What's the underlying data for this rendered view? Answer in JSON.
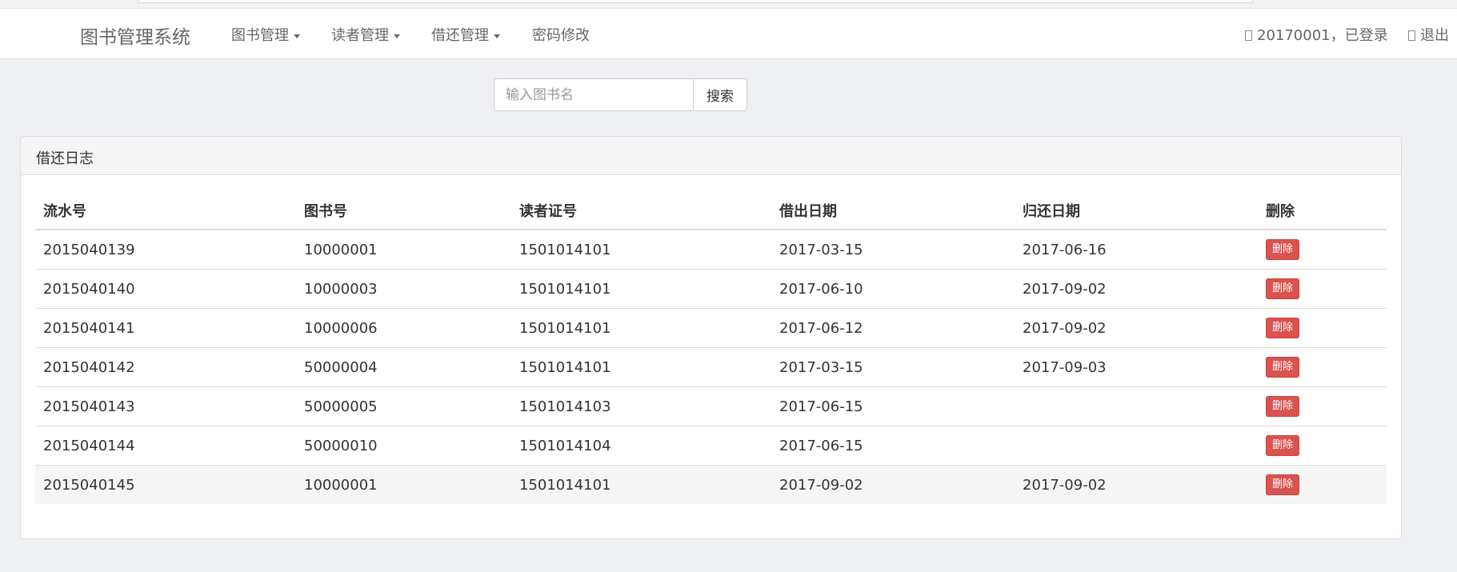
{
  "navbar": {
    "brand": "图书管理系统",
    "menu": [
      {
        "label": "图书管理",
        "dropdown": true
      },
      {
        "label": "读者管理",
        "dropdown": true
      },
      {
        "label": "借还管理",
        "dropdown": true
      },
      {
        "label": "密码修改",
        "dropdown": false
      }
    ],
    "user_status": "20170001，已登录",
    "logout_label": "退出"
  },
  "search": {
    "placeholder": "输入图书名",
    "value": "",
    "button_label": "搜索"
  },
  "panel": {
    "title": "借还日志",
    "columns": [
      "流水号",
      "图书号",
      "读者证号",
      "借出日期",
      "归还日期",
      "删除"
    ],
    "rows": [
      {
        "serial": "2015040139",
        "book_id": "10000001",
        "reader_id": "1501014101",
        "lend_date": "2017-03-15",
        "return_date": "2017-06-16",
        "delete_label": "删除"
      },
      {
        "serial": "2015040140",
        "book_id": "10000003",
        "reader_id": "1501014101",
        "lend_date": "2017-06-10",
        "return_date": "2017-09-02",
        "delete_label": "删除"
      },
      {
        "serial": "2015040141",
        "book_id": "10000006",
        "reader_id": "1501014101",
        "lend_date": "2017-06-12",
        "return_date": "2017-09-02",
        "delete_label": "删除"
      },
      {
        "serial": "2015040142",
        "book_id": "50000004",
        "reader_id": "1501014101",
        "lend_date": "2017-03-15",
        "return_date": "2017-09-03",
        "delete_label": "删除"
      },
      {
        "serial": "2015040143",
        "book_id": "50000005",
        "reader_id": "1501014103",
        "lend_date": "2017-06-15",
        "return_date": "",
        "delete_label": "删除"
      },
      {
        "serial": "2015040144",
        "book_id": "50000010",
        "reader_id": "1501014104",
        "lend_date": "2017-06-15",
        "return_date": "",
        "delete_label": "删除"
      },
      {
        "serial": "2015040145",
        "book_id": "10000001",
        "reader_id": "1501014101",
        "lend_date": "2017-09-02",
        "return_date": "2017-09-02",
        "delete_label": "删除"
      }
    ]
  },
  "colors": {
    "page_background": "#eff0f3",
    "danger": "#d9534f",
    "text": "#333333",
    "nav_text": "#666666"
  },
  "icons": {
    "user": "user-icon",
    "logout": "logout-icon",
    "dropdown": "caret-down-icon"
  }
}
